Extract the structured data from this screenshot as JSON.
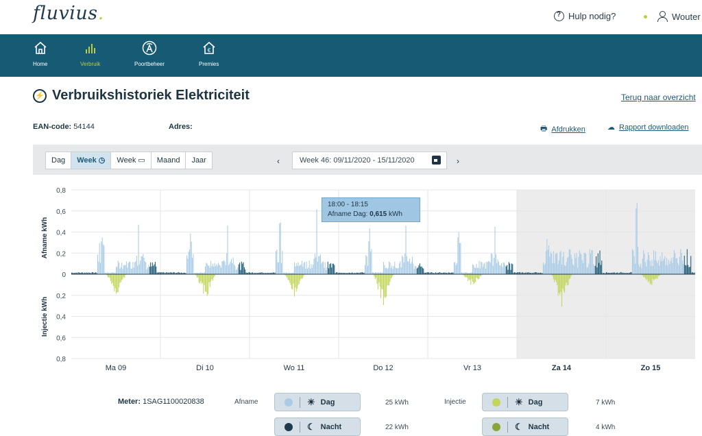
{
  "header": {
    "logo": "fluvius",
    "logo_dot": ".",
    "help": "Hulp nodig?",
    "user": "Wouter"
  },
  "nav": {
    "items": [
      {
        "label": "Home",
        "icon": "house-icon"
      },
      {
        "label": "Verbruik",
        "icon": "bar-chart-icon"
      },
      {
        "label": "Poortbeheer",
        "icon": "antenna-icon"
      },
      {
        "label": "Premies",
        "icon": "euro-house-icon"
      }
    ],
    "active": "Verbruik",
    "bg_color": "#165a73",
    "active_color": "#b9cf3b"
  },
  "page": {
    "title": "Verbruikshistoriek Elektriciteit",
    "back_link": "Terug naar overzicht",
    "ean_label": "EAN-code:",
    "ean_value": "54144",
    "adres_label": "Adres:",
    "print": "Afdrukken",
    "download": "Rapport downloaden"
  },
  "toolbar": {
    "periods": [
      "Dag",
      "Week",
      "Week",
      "Maand",
      "Jaar"
    ],
    "selected": "Week",
    "week_range": "Week 46: 09/11/2020 - 15/11/2020",
    "prev": "‹",
    "next": "›"
  },
  "chart_data": {
    "type": "bar",
    "y_label_top": "Afname  kWh",
    "y_label_bottom": "Injectie  kWh",
    "y_ticks_top": [
      "0,8",
      "0,6",
      "0,4",
      "0,2",
      "0"
    ],
    "y_ticks_bottom": [
      "0,2",
      "0,4",
      "0,6",
      "0,8"
    ],
    "ylim": [
      -0.8,
      0.8
    ],
    "days": [
      "Ma 09",
      "Di 10",
      "Wo 11",
      "Do 12",
      "Vr 13",
      "Za 14",
      "Zo 15"
    ],
    "weekend_days": [
      "Za 14",
      "Zo 15"
    ],
    "day_peaks": [
      {
        "day": "Ma 09",
        "afname_max": 0.47,
        "injectie_max": 0.22
      },
      {
        "day": "Di 10",
        "afname_max": 0.46,
        "injectie_max": 0.27
      },
      {
        "day": "Wo 11",
        "afname_max": 0.615,
        "injectie_max": 0.22
      },
      {
        "day": "Do 12",
        "afname_max": 0.46,
        "injectie_max": 0.33
      },
      {
        "day": "Vr 13",
        "afname_max": 0.45,
        "injectie_max": 0.13
      },
      {
        "day": "Za 14",
        "afname_max": 0.36,
        "injectie_max": 0.34
      },
      {
        "day": "Zo 15",
        "afname_max": 0.72,
        "injectie_max": 0.13
      }
    ],
    "colors": {
      "afname_dag": "#a9cbe6",
      "afname_nacht": "#1e5a74",
      "injectie_dag": "#c2d65a",
      "injectie_nacht": "#8aa63a",
      "weekend_bg": "#ececec"
    },
    "tooltip": {
      "time": "18:00 - 18:15",
      "label": "Afname Dag:",
      "value": "0,615",
      "unit": "kWh"
    }
  },
  "legend": {
    "meter_label": "Meter:",
    "meter_value": "1SAG1100020838",
    "afname": "Afname",
    "injectie": "Injectie",
    "dag": "Dag",
    "nacht": "Nacht",
    "afname_dag_kwh": "25 kWh",
    "afname_nacht_kwh": "22 kWh",
    "injectie_dag_kwh": "7 kWh",
    "injectie_nacht_kwh": "4 kWh"
  }
}
